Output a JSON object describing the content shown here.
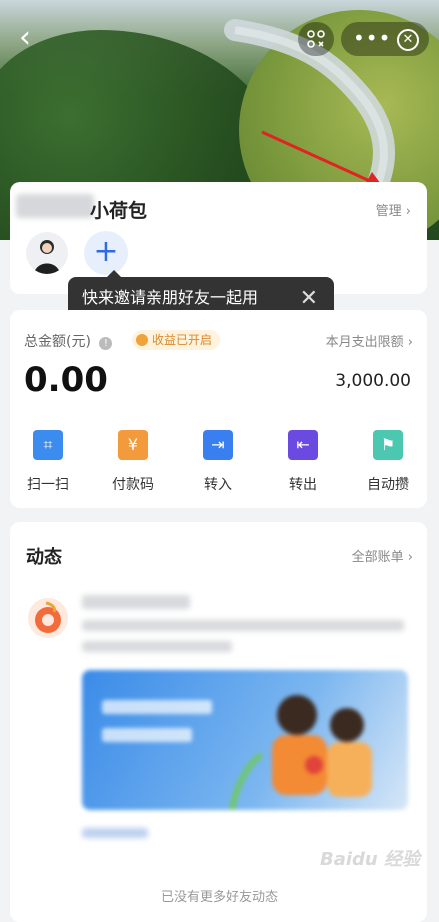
{
  "header": {
    "title_suffix": "小荷包",
    "manage_label": "管理",
    "back_icon": "chevron-left-icon",
    "scan_icon": "scan-icon",
    "more_icon": "more-dots-icon",
    "close_icon": "close-circle-icon"
  },
  "members": {
    "add_symbol": "+"
  },
  "tooltip": {
    "text": "快来邀请亲朋好友一起用",
    "close_symbol": "✕"
  },
  "account": {
    "total_label": "总金额(元)",
    "badge_label": "收益已开启",
    "limit_label": "本月支出限额",
    "amount": "0.00",
    "limit_value": "3,000.00"
  },
  "actions": [
    {
      "label": "扫一扫",
      "icon": "scan-icon",
      "color": "#3c8cf0",
      "glyph": "⌗"
    },
    {
      "label": "付款码",
      "icon": "yuan-icon",
      "color": "#f29a3c",
      "glyph": "¥"
    },
    {
      "label": "转入",
      "icon": "transfer-in-icon",
      "color": "#3a7ff0",
      "glyph": "⇥"
    },
    {
      "label": "转出",
      "icon": "transfer-out-icon",
      "color": "#6a4ae0",
      "glyph": "⇤"
    },
    {
      "label": "自动攒",
      "icon": "flag-icon",
      "color": "#4cc8b0",
      "glyph": "⚑"
    }
  ],
  "activity": {
    "title": "动态",
    "all_bills": "全部账单",
    "empty_note": "已没有更多好友动态"
  },
  "watermark": "Baidu 经验",
  "colors": {
    "accent": "#2f6be0",
    "badge_bg": "#fff3dd",
    "badge_text": "#d8892d"
  }
}
